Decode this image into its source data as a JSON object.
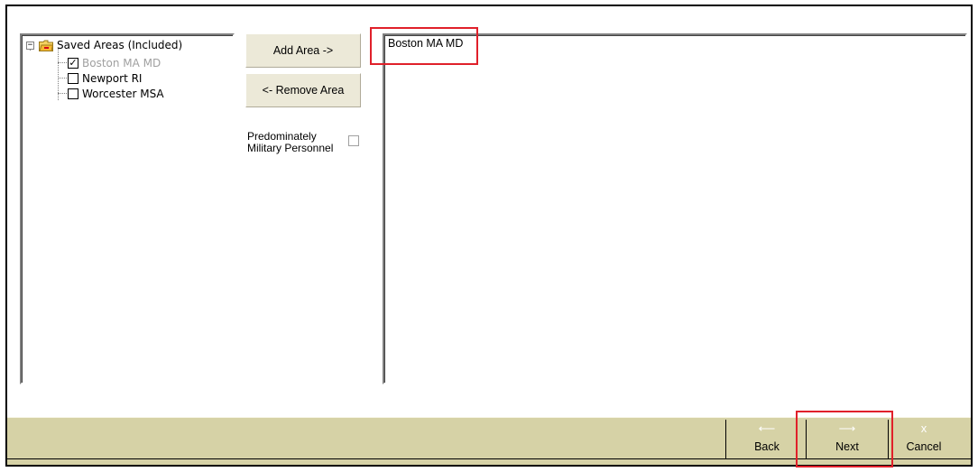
{
  "tree": {
    "root_label": "Saved Areas (Included)",
    "items": [
      {
        "label": "Boston MA MD",
        "checked": true,
        "disabled": true
      },
      {
        "label": "Newport RI",
        "checked": false,
        "disabled": false
      },
      {
        "label": "Worcester MSA",
        "checked": false,
        "disabled": false
      }
    ]
  },
  "buttons": {
    "add_area": "Add Area ->",
    "remove_area": "<- Remove Area"
  },
  "options": {
    "military_label": "Predominately\nMilitary Personnel",
    "military_checked": false
  },
  "selected_list": {
    "items": [
      "Boston MA MD"
    ]
  },
  "navigation": {
    "back_label": "Back",
    "back_glyph": "⟵",
    "next_label": "Next",
    "next_glyph": "⟶",
    "cancel_label": "Cancel",
    "cancel_glyph": "x"
  },
  "colors": {
    "bar_background": "#d6d2a6",
    "highlight": "#e0202a"
  }
}
